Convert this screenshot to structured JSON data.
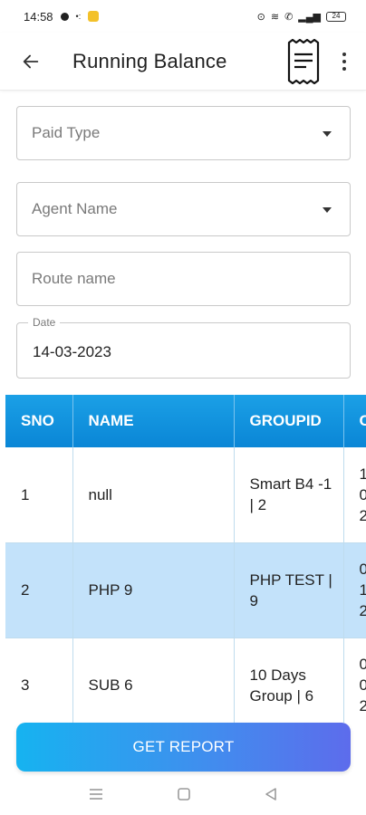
{
  "status_bar": {
    "time": "14:58",
    "battery": "24"
  },
  "app_bar": {
    "title": "Running Balance"
  },
  "form": {
    "paid_type": {
      "placeholder": "Paid Type"
    },
    "agent_name": {
      "placeholder": "Agent Name"
    },
    "route_name": {
      "placeholder": "Route name"
    },
    "date": {
      "label": "Date",
      "value": "14-03-2023"
    }
  },
  "table": {
    "columns": [
      "SNO",
      "NAME",
      "GROUPID",
      "C"
    ],
    "rows": [
      {
        "sno": "1",
        "name": "null",
        "groupid": "Smart B4 -1 | 2",
        "col4": "1\n0\n2"
      },
      {
        "sno": "2",
        "name": "PHP 9",
        "groupid": "PHP TEST | 9",
        "col4": "0\n1\n2"
      },
      {
        "sno": "3",
        "name": "SUB 6",
        "groupid": "10 Days Group | 6",
        "col4": "0\n0\n2"
      }
    ]
  },
  "actions": {
    "get_report": "GET REPORT"
  },
  "icons": {
    "back": "arrow-left-icon",
    "receipt": "receipt-icon",
    "more": "more-vertical-icon",
    "nav_menu": "menu-icon",
    "nav_home": "square-icon",
    "nav_back": "triangle-back-icon"
  },
  "colors": {
    "header_blue": "#0a86d6",
    "row_highlight": "#c3e2fa",
    "button_gradient_start": "#16b3f0",
    "button_gradient_end": "#5d6cec"
  }
}
